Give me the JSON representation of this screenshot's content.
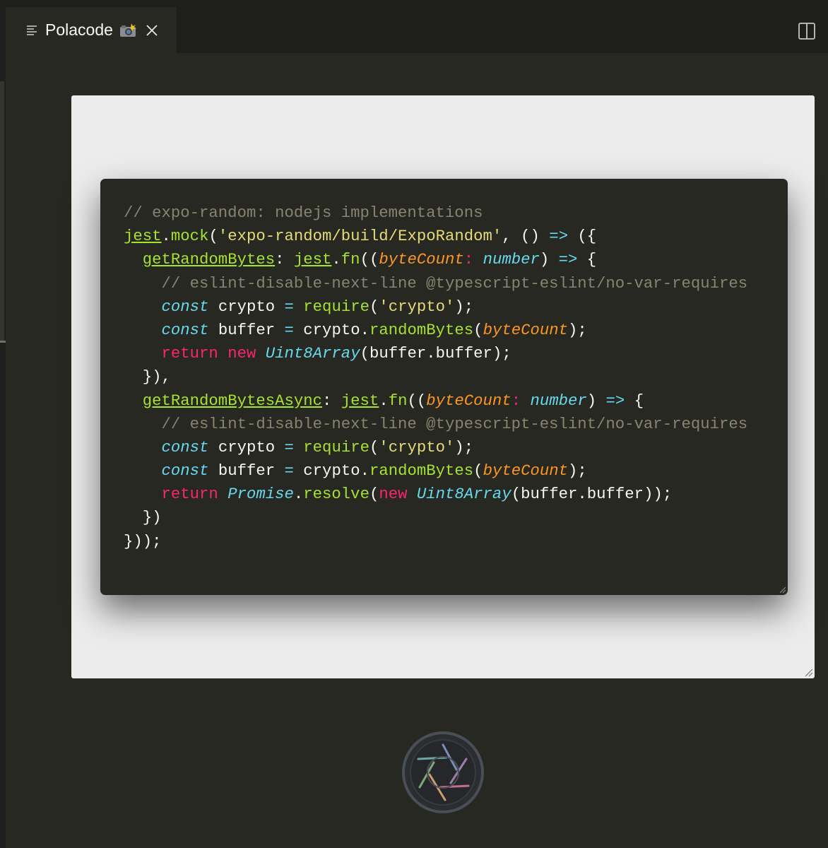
{
  "tab": {
    "title": "Polacode",
    "emoji": "📸",
    "menu_icon": "lines-icon",
    "close_icon": "close-icon"
  },
  "toolbar": {
    "split_icon": "split-editor-icon"
  },
  "code": {
    "language": "typescript",
    "theme_colors": {
      "background": "#272822",
      "foreground": "#f8f8f2",
      "comment": "#88846f",
      "keyword": "#f92672",
      "string": "#e6db74",
      "function": "#a6e22e",
      "type": "#66d9ef",
      "parameter": "#fd971f"
    },
    "lines": [
      "// expo-random: nodejs implementations",
      "jest.mock('expo-random/build/ExpoRandom', () => ({",
      "  getRandomBytes: jest.fn((byteCount: number) => {",
      "    // eslint-disable-next-line @typescript-eslint/no-var-requires",
      "    const crypto = require('crypto');",
      "    const buffer = crypto.randomBytes(byteCount);",
      "    return new Uint8Array(buffer.buffer);",
      "  }),",
      "  getRandomBytesAsync: jest.fn((byteCount: number) => {",
      "    // eslint-disable-next-line @typescript-eslint/no-var-requires",
      "    const crypto = require('crypto');",
      "    const buffer = crypto.randomBytes(byteCount);",
      "    return Promise.resolve(new Uint8Array(buffer.buffer));",
      "  })",
      "}));"
    ]
  },
  "shutter": {
    "icon": "camera-shutter-icon"
  }
}
